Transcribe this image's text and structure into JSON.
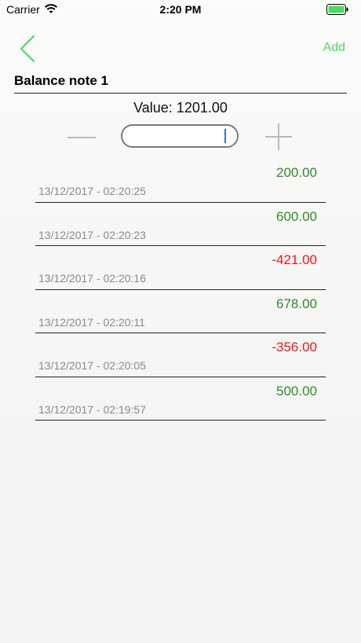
{
  "status_bar": {
    "carrier": "Carrier",
    "time": "2:20 PM",
    "wifi_icon": "wifi-icon",
    "battery_icon": "battery-icon"
  },
  "nav": {
    "back_icon": "chevron-left-icon",
    "add_label": "Add"
  },
  "note": {
    "title": "Balance note 1",
    "value_label": "Value:",
    "value": "1201.00"
  },
  "stepper": {
    "minus_icon": "minus-icon",
    "plus_icon": "plus-icon",
    "input_value": ""
  },
  "colors": {
    "accent": "#4cd964",
    "positive": "#2e8b2e",
    "negative": "#e8181b",
    "date_text": "#8a8a8a"
  },
  "entries": [
    {
      "amount": "200.00",
      "date": "13/12/2017 - 02:20:25",
      "sign": "pos"
    },
    {
      "amount": "600.00",
      "date": "13/12/2017 - 02:20:23",
      "sign": "pos"
    },
    {
      "amount": "-421.00",
      "date": "13/12/2017 - 02:20:16",
      "sign": "neg"
    },
    {
      "amount": "678.00",
      "date": "13/12/2017 - 02:20:11",
      "sign": "pos"
    },
    {
      "amount": "-356.00",
      "date": "13/12/2017 - 02:20:05",
      "sign": "neg"
    },
    {
      "amount": "500.00",
      "date": "13/12/2017 - 02:19:57",
      "sign": "pos"
    }
  ]
}
